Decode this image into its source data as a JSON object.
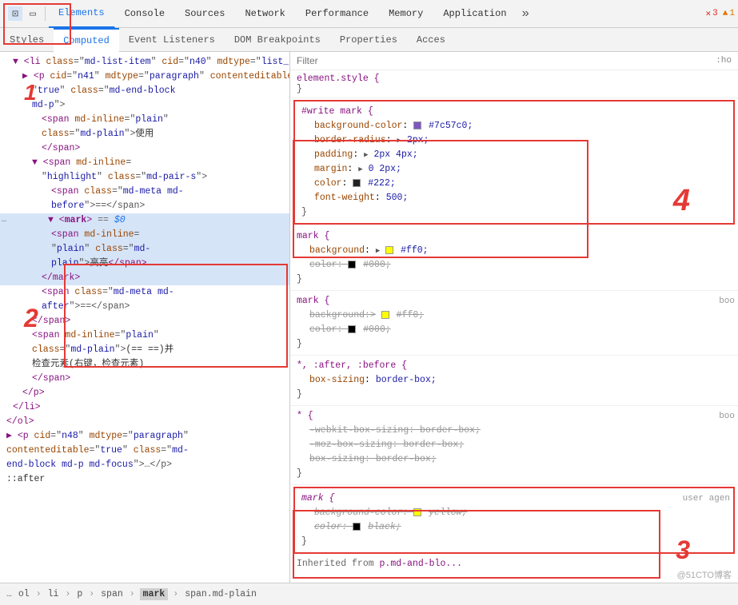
{
  "toolbar": {
    "icons": [
      {
        "name": "cursor-icon",
        "symbol": "⊡"
      },
      {
        "name": "device-icon",
        "symbol": "▭"
      }
    ],
    "tabs": [
      {
        "label": "Elements",
        "active": true
      },
      {
        "label": "Console"
      },
      {
        "label": "Sources"
      },
      {
        "label": "Network"
      },
      {
        "label": "Performance"
      },
      {
        "label": "Memory"
      },
      {
        "label": "Application"
      },
      {
        "label": "»"
      }
    ],
    "errors": {
      "count": "3",
      "warnings": "1"
    }
  },
  "subtabs": {
    "tabs": [
      {
        "label": "Styles",
        "active": false
      },
      {
        "label": "Computed",
        "active": false
      },
      {
        "label": "Event Listeners"
      },
      {
        "label": "DOM Breakpoints"
      },
      {
        "label": "Properties"
      },
      {
        "label": "Acces"
      }
    ]
  },
  "filter": {
    "placeholder": "Filter",
    "hint": ":ho"
  },
  "dom": {
    "lines": [
      {
        "indent": 1,
        "content": "li_open",
        "text": "▶ <li class=\"md-list-item\" cid=\"n40\" mdtype=\"list_item\">"
      },
      {
        "indent": 2,
        "content": "p_open",
        "text": "▶ <p cid=\"n41\" mdtype=\"paragraph\" contenteditable=\"true\" class=\"md-end-block md-p\">"
      },
      {
        "indent": 3,
        "content": "span1",
        "text": "<span md-inline=\"plain\" class=\"md-plain\">使用"
      },
      {
        "indent": 3,
        "content": "span1_close",
        "text": "</span>"
      },
      {
        "indent": 3,
        "content": "span2_open",
        "text": "▼ <span md-inline="
      },
      {
        "indent": 3,
        "content": "span2_highlight",
        "text": "\"highlight\" class=\"md-pair-s\">"
      },
      {
        "indent": 4,
        "content": "span_meta",
        "text": "<span class=\"md-meta md-before\">==</span>"
      },
      {
        "indent": 3,
        "content": "mark_open",
        "text": "▼ <mark> == $0",
        "selected": true
      },
      {
        "indent": 4,
        "content": "span_plain",
        "text": "<span md-inline="
      },
      {
        "indent": 4,
        "content": "span_plain2",
        "text": "\"plain\" class=\"md-plain\">高亮</span>"
      },
      {
        "indent": 3,
        "content": "mark_close",
        "text": "</mark>",
        "selected": true
      },
      {
        "indent": 3,
        "content": "span_after",
        "text": "<span class=\"md-meta md-after\">=≡</span>"
      },
      {
        "indent": 2,
        "content": "span_close",
        "text": "</span>"
      },
      {
        "indent": 2,
        "content": "span_plain3",
        "text": "<span md-inline=\"plain\""
      },
      {
        "indent": 2,
        "content": "span_plain4",
        "text": "class=\"md-plain\">(== ==)并"
      },
      {
        "indent": 2,
        "content": "inspect",
        "text": "检查元素(右键，检查元素)"
      },
      {
        "indent": 2,
        "content": "span_close2",
        "text": "</span>"
      },
      {
        "indent": 1,
        "content": "p_close",
        "text": "</p>"
      },
      {
        "indent": 0,
        "content": "li_close",
        "text": "</li>"
      },
      {
        "indent": 0,
        "content": "ol_close",
        "text": "</ol>"
      },
      {
        "indent": 0,
        "content": "p_n48",
        "text": "▶ <p cid=\"n48\" mdtype=\"paragraph\""
      },
      {
        "indent": 0,
        "content": "p_n48_2",
        "text": "contenteditable=\"true\" class=\"md-"
      },
      {
        "indent": 0,
        "content": "p_n48_3",
        "text": "end-block md-p md-focus\">…</p>"
      },
      {
        "indent": 0,
        "content": "after",
        "text": "::after"
      }
    ]
  },
  "styles": {
    "element_style": "element.style {",
    "element_close": "}",
    "rules": [
      {
        "id": "rule1",
        "selector": "#write mark {",
        "properties": [
          {
            "name": "background-color",
            "value": "#7c57c0",
            "swatch": "#7c57c0",
            "has_swatch": true
          },
          {
            "name": "border-radius",
            "value": "2px",
            "has_triangle": true
          },
          {
            "name": "padding",
            "value": "2px 4px",
            "has_triangle": true
          },
          {
            "name": "margin",
            "value": "0 2px",
            "has_triangle": true
          },
          {
            "name": "color",
            "value": "#222",
            "swatch": "#222",
            "has_swatch": true
          },
          {
            "name": "font-weight",
            "value": "500"
          }
        ],
        "highlighted": true
      },
      {
        "id": "rule2",
        "selector": "mark {",
        "properties": [
          {
            "name": "background",
            "value": "#ff0",
            "swatch": "#ff0",
            "has_swatch": true,
            "has_triangle": true
          },
          {
            "name": "color",
            "value": "#000",
            "swatch": "#000",
            "has_swatch": true,
            "strikethrough": true
          }
        ],
        "highlighted": false
      },
      {
        "id": "rule3",
        "selector": "mark {",
        "properties": [
          {
            "name": "background",
            "value": "#ff0",
            "swatch": "#ff0",
            "has_swatch": true,
            "has_triangle": true,
            "strikethrough": true
          },
          {
            "name": "color",
            "value": "#000",
            "swatch": "#000",
            "has_swatch": true,
            "strikethrough": true
          }
        ],
        "source": "boo",
        "highlighted": false
      },
      {
        "id": "rule4",
        "selector": "*, :after, :before {",
        "properties": [
          {
            "name": "box-sizing",
            "value": "border-box"
          }
        ],
        "highlighted": false
      },
      {
        "id": "rule5",
        "selector": "* {",
        "properties": [
          {
            "name": "-webkit-box-sizing",
            "value": "border-box",
            "strikethrough": true
          },
          {
            "name": "-moz-box-sizing",
            "value": "border-box",
            "strikethrough": true
          },
          {
            "name": "box-sizing",
            "value": "border-box",
            "strikethrough": true
          }
        ],
        "source": "boo",
        "highlighted": false
      },
      {
        "id": "rule6",
        "selector": "mark {",
        "properties": [
          {
            "name": "background-color",
            "value": "yellow",
            "swatch": "#ffff00",
            "has_swatch": true,
            "strikethrough": true,
            "italic": true
          },
          {
            "name": "color",
            "value": "black",
            "swatch": "#000000",
            "has_swatch": true,
            "strikethrough": true,
            "italic": true
          }
        ],
        "source": "user agen",
        "highlighted": true,
        "italic_selector": true
      }
    ]
  },
  "breadcrumb": {
    "items": [
      "ol",
      "li",
      "p",
      "span",
      "mark",
      "span.md-plain"
    ]
  },
  "annotations": {
    "num1": "1",
    "num2": "2",
    "num3": "3",
    "num4": "4"
  },
  "watermark": "@51CTO博客"
}
